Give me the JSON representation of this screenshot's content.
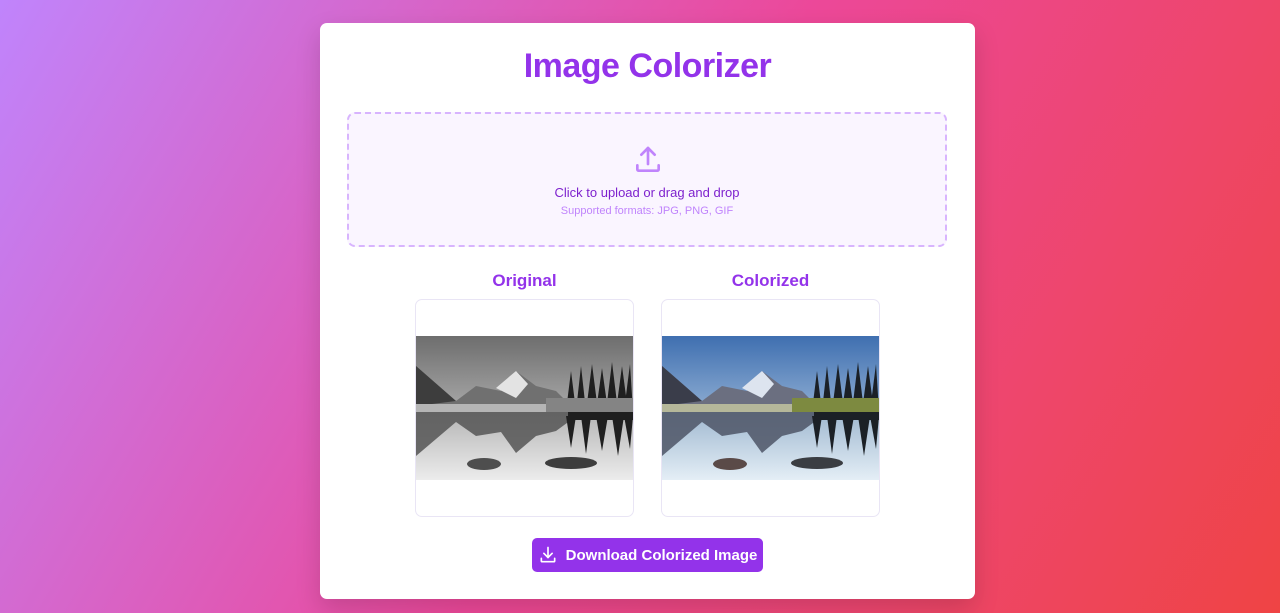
{
  "app": {
    "title": "Image Colorizer"
  },
  "upload": {
    "icon": "upload-icon",
    "primary_text": "Click to upload or drag and drop",
    "secondary_text": "Supported formats: JPG, PNG, GIF"
  },
  "panels": {
    "original_label": "Original",
    "colorized_label": "Colorized"
  },
  "actions": {
    "download_label": "Download Colorized Image",
    "download_icon": "download-icon"
  },
  "colors": {
    "accent": "#9333ea",
    "upload_bg": "#faf5ff",
    "upload_border": "#d8b4fe"
  }
}
